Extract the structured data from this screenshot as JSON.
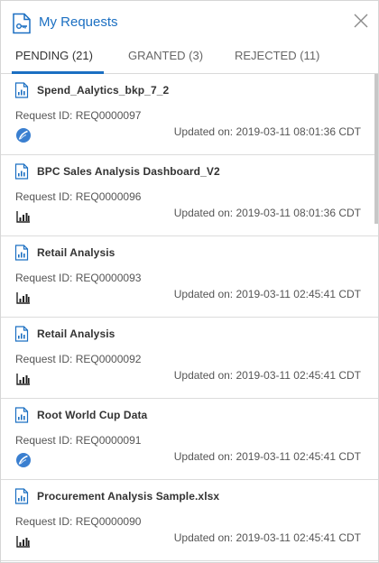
{
  "header": {
    "title": "My Requests"
  },
  "tabs": [
    {
      "label": "PENDING (21)"
    },
    {
      "label": "GRANTED (3)"
    },
    {
      "label": "REJECTED (11)"
    }
  ],
  "requests": [
    {
      "name": "Spend_Aalytics_bkp_7_2",
      "request_id": "Request ID: REQ0000097",
      "updated": "Updated on: 2019-03-11 08:01:36 CDT",
      "type_icon": "leaf-badge-icon"
    },
    {
      "name": "BPC Sales Analysis Dashboard_V2",
      "request_id": "Request ID: REQ0000096",
      "updated": "Updated on: 2019-03-11 08:01:36 CDT",
      "type_icon": "bar-chart-icon"
    },
    {
      "name": "Retail Analysis",
      "request_id": "Request ID: REQ0000093",
      "updated": "Updated on: 2019-03-11 02:45:41 CDT",
      "type_icon": "bar-chart-icon"
    },
    {
      "name": "Retail Analysis",
      "request_id": "Request ID: REQ0000092",
      "updated": "Updated on: 2019-03-11 02:45:41 CDT",
      "type_icon": "bar-chart-icon"
    },
    {
      "name": "Root World Cup Data",
      "request_id": "Request ID: REQ0000091",
      "updated": "Updated on: 2019-03-11 02:45:41 CDT",
      "type_icon": "leaf-badge-icon"
    },
    {
      "name": "Procurement Analysis Sample.xlsx",
      "request_id": "Request ID: REQ0000090",
      "updated": "Updated on: 2019-03-11 02:45:41 CDT",
      "type_icon": "bar-chart-icon"
    }
  ],
  "colors": {
    "accent": "#1b6fc2",
    "text": "#333333",
    "badge_blue": "#3a7fd0"
  }
}
